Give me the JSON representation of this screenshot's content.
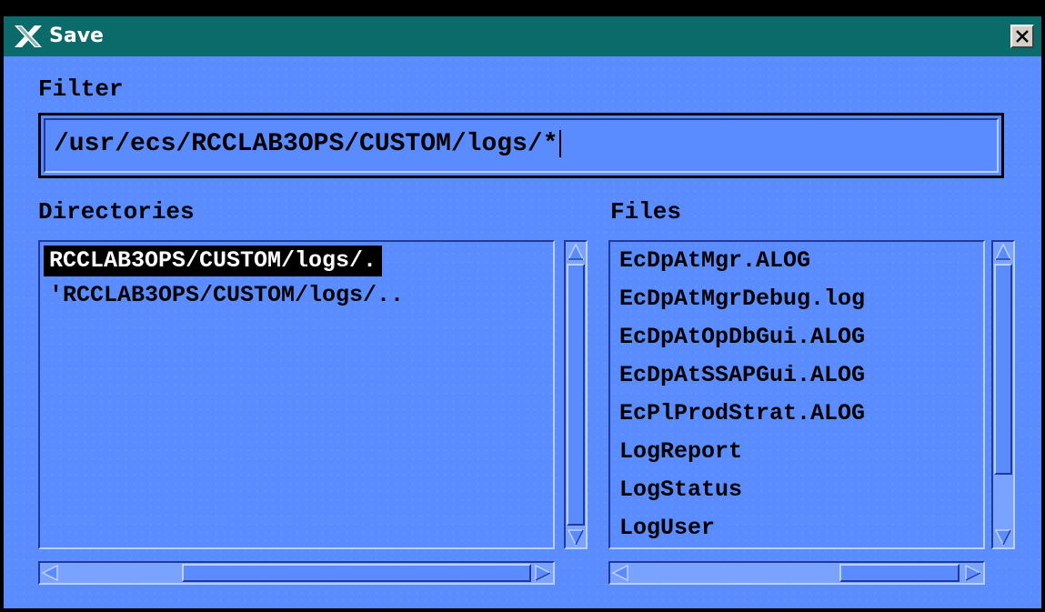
{
  "window": {
    "title": "Save",
    "title_icon": "x-window-icon",
    "close_icon": "close-icon",
    "titlebar_color": "#0b6a6a",
    "body_color": "#5a8cff"
  },
  "filter": {
    "label": "Filter",
    "value": "/usr/ecs/RCCLAB3OPS/CUSTOM/logs/*"
  },
  "directories": {
    "label": "Directories",
    "items": [
      {
        "label": "RCCLAB3OPS/CUSTOM/logs/.",
        "selected": true
      },
      {
        "label": "'RCCLAB3OPS/CUSTOM/logs/..",
        "selected": false
      }
    ]
  },
  "files": {
    "label": "Files",
    "items": [
      "EcDpAtMgr.ALOG",
      "EcDpAtMgrDebug.log",
      "EcDpAtOpDbGui.ALOG",
      "EcDpAtSSAPGui.ALOG",
      "EcPlProdStrat.ALOG",
      "LogReport",
      "LogStatus",
      "LogUser"
    ]
  }
}
